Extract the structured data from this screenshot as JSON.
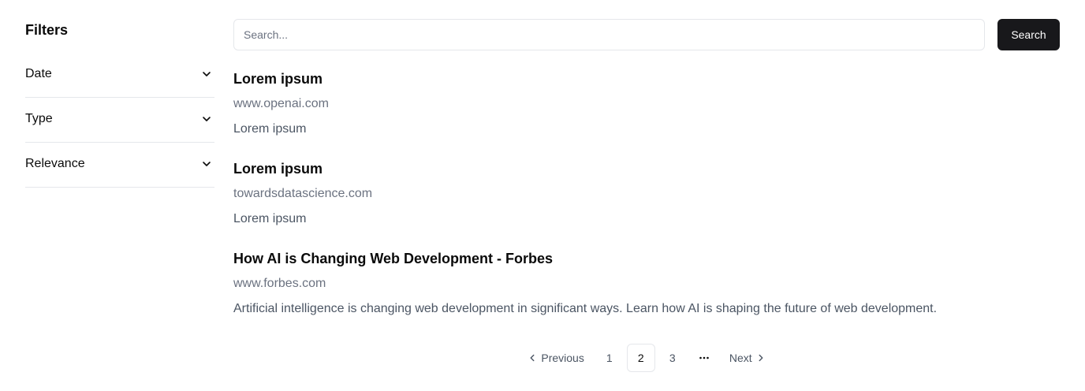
{
  "sidebar": {
    "title": "Filters",
    "filters": [
      {
        "label": "Date",
        "icon": "chevron-down-icon"
      },
      {
        "label": "Type",
        "icon": "chevron-down-icon"
      },
      {
        "label": "Relevance",
        "icon": "chevron-down-icon"
      }
    ]
  },
  "search": {
    "placeholder": "Search...",
    "value": "",
    "button_label": "Search"
  },
  "results": [
    {
      "title": "Lorem ipsum",
      "url": "www.openai.com",
      "snippet": "Lorem ipsum"
    },
    {
      "title": "Lorem ipsum",
      "url": "towardsdatascience.com",
      "snippet": "Lorem ipsum"
    },
    {
      "title": "How AI is Changing Web Development - Forbes",
      "url": "www.forbes.com",
      "snippet": "Artificial intelligence is changing web development in significant ways. Learn how AI is shaping the future of web development."
    }
  ],
  "pagination": {
    "previous_label": "Previous",
    "next_label": "Next",
    "pages": [
      "1",
      "2",
      "3"
    ],
    "current_page": "2"
  },
  "colors": {
    "primary_button": "#18181b",
    "border": "#e5e7eb",
    "muted_text": "#6b7280"
  }
}
